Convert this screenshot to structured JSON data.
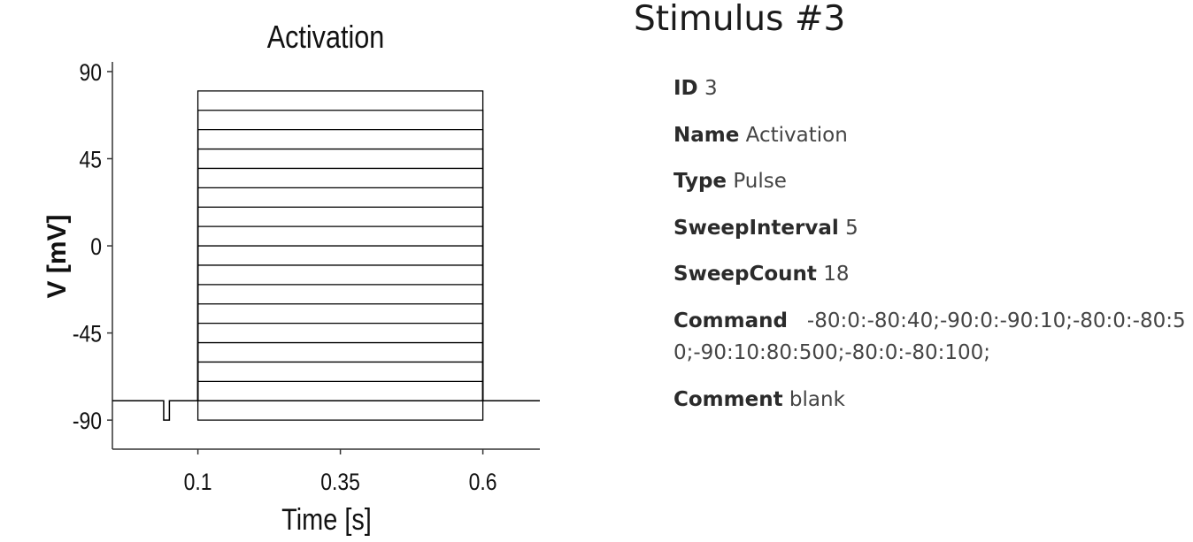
{
  "page": {
    "title": "Stimulus #3"
  },
  "details": [
    {
      "label": "ID",
      "value": "3"
    },
    {
      "label": "Name",
      "value": "Activation"
    },
    {
      "label": "Type",
      "value": "Pulse"
    },
    {
      "label": "SweepInterval",
      "value": "5"
    },
    {
      "label": "SweepCount",
      "value": "18"
    },
    {
      "label": "Command",
      "value": "-80:0:-80:40;-90:0:-90:10;-80:0:-80:50;-90:10:80:500;-80:0:-80:100;"
    },
    {
      "label": "Comment",
      "value": "blank"
    }
  ],
  "chart_data": {
    "type": "line",
    "title": "Activation",
    "xlabel": "Time [s]",
    "ylabel": "V [mV]",
    "xlim": [
      -0.05,
      0.7
    ],
    "ylim": [
      -105,
      95
    ],
    "xticks": [
      0.1,
      0.35,
      0.6
    ],
    "xtick_labels": [
      "0.1",
      "0.35",
      "0.6"
    ],
    "yticks": [
      -90,
      -45,
      0,
      45,
      90
    ],
    "ytick_labels": [
      "-90",
      "-45",
      "0",
      "45",
      "90"
    ],
    "grid": false,
    "holding_mV": -80,
    "prepulse": {
      "start_s": 0.04,
      "end_s": 0.05,
      "level_mV": -90
    },
    "pulse": {
      "start_s": 0.1,
      "end_s": 0.6,
      "levels_mV": [
        -90,
        -80,
        -70,
        -60,
        -50,
        -40,
        -30,
        -20,
        -10,
        0,
        10,
        20,
        30,
        40,
        50,
        60,
        70,
        80
      ]
    },
    "trace_end_s": 0.7,
    "line_color": "#000000"
  }
}
